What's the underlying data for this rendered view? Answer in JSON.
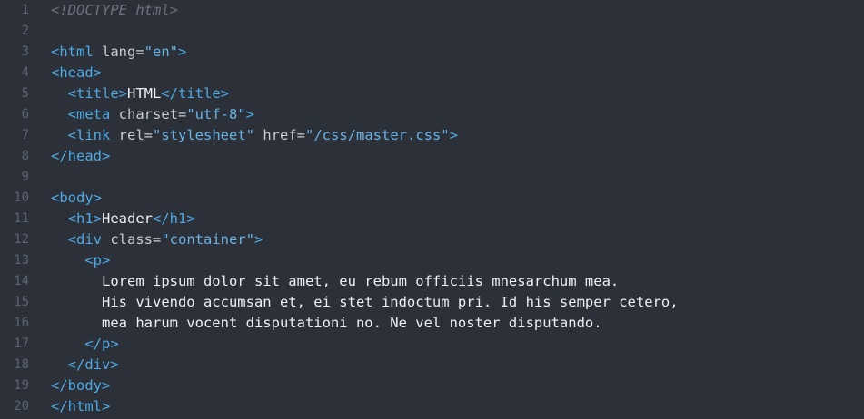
{
  "colors": {
    "background": "#2c3038",
    "line_number": "#5c6370",
    "tag": "#4fa9e3",
    "attribute": "#c7ccd5",
    "string": "#6ab3e6",
    "text": "#eef0f3",
    "comment": "#6c727d"
  },
  "lines": [
    {
      "num": "1",
      "tokens": [
        {
          "t": "doctype",
          "v": "<!DOCTYPE html>"
        }
      ]
    },
    {
      "num": "2",
      "tokens": []
    },
    {
      "num": "3",
      "tokens": [
        {
          "t": "tag",
          "v": "<html"
        },
        {
          "t": "attr",
          "v": " lang="
        },
        {
          "t": "str",
          "v": "\"en\""
        },
        {
          "t": "tag",
          "v": ">"
        }
      ]
    },
    {
      "num": "4",
      "tokens": [
        {
          "t": "tag",
          "v": "<head>"
        }
      ]
    },
    {
      "num": "5",
      "tokens": [
        {
          "t": "text",
          "v": "  "
        },
        {
          "t": "tag",
          "v": "<title>"
        },
        {
          "t": "text",
          "v": "HTML"
        },
        {
          "t": "tag",
          "v": "</title>"
        }
      ]
    },
    {
      "num": "6",
      "tokens": [
        {
          "t": "text",
          "v": "  "
        },
        {
          "t": "tag",
          "v": "<meta"
        },
        {
          "t": "attr",
          "v": " charset="
        },
        {
          "t": "str",
          "v": "\"utf-8\""
        },
        {
          "t": "tag",
          "v": ">"
        }
      ]
    },
    {
      "num": "7",
      "tokens": [
        {
          "t": "text",
          "v": "  "
        },
        {
          "t": "tag",
          "v": "<link"
        },
        {
          "t": "attr",
          "v": " rel="
        },
        {
          "t": "str",
          "v": "\"stylesheet\""
        },
        {
          "t": "attr",
          "v": " href="
        },
        {
          "t": "str",
          "v": "\"/css/master.css\""
        },
        {
          "t": "tag",
          "v": ">"
        }
      ]
    },
    {
      "num": "8",
      "tokens": [
        {
          "t": "tag",
          "v": "</head>"
        }
      ]
    },
    {
      "num": "9",
      "tokens": []
    },
    {
      "num": "10",
      "tokens": [
        {
          "t": "tag",
          "v": "<body>"
        }
      ]
    },
    {
      "num": "11",
      "tokens": [
        {
          "t": "text",
          "v": "  "
        },
        {
          "t": "tag",
          "v": "<h1>"
        },
        {
          "t": "text",
          "v": "Header"
        },
        {
          "t": "tag",
          "v": "</h1>"
        }
      ]
    },
    {
      "num": "12",
      "tokens": [
        {
          "t": "text",
          "v": "  "
        },
        {
          "t": "tag",
          "v": "<div"
        },
        {
          "t": "attr",
          "v": " class="
        },
        {
          "t": "str",
          "v": "\"container\""
        },
        {
          "t": "tag",
          "v": ">"
        }
      ]
    },
    {
      "num": "13",
      "tokens": [
        {
          "t": "text",
          "v": "    "
        },
        {
          "t": "tag",
          "v": "<p>"
        }
      ]
    },
    {
      "num": "14",
      "tokens": [
        {
          "t": "text",
          "v": "      Lorem ipsum dolor sit amet, eu rebum officiis mnesarchum mea."
        }
      ]
    },
    {
      "num": "15",
      "tokens": [
        {
          "t": "text",
          "v": "      His vivendo accumsan et, ei stet indoctum pri. Id his semper cetero,"
        }
      ]
    },
    {
      "num": "16",
      "tokens": [
        {
          "t": "text",
          "v": "      mea harum vocent disputationi no. Ne vel noster disputando."
        }
      ]
    },
    {
      "num": "17",
      "tokens": [
        {
          "t": "text",
          "v": "    "
        },
        {
          "t": "tag",
          "v": "</p>"
        }
      ]
    },
    {
      "num": "18",
      "tokens": [
        {
          "t": "text",
          "v": "  "
        },
        {
          "t": "tag",
          "v": "</div>"
        }
      ]
    },
    {
      "num": "19",
      "tokens": [
        {
          "t": "tag",
          "v": "</body>"
        }
      ]
    },
    {
      "num": "20",
      "tokens": [
        {
          "t": "tag",
          "v": "</html>"
        }
      ]
    }
  ]
}
